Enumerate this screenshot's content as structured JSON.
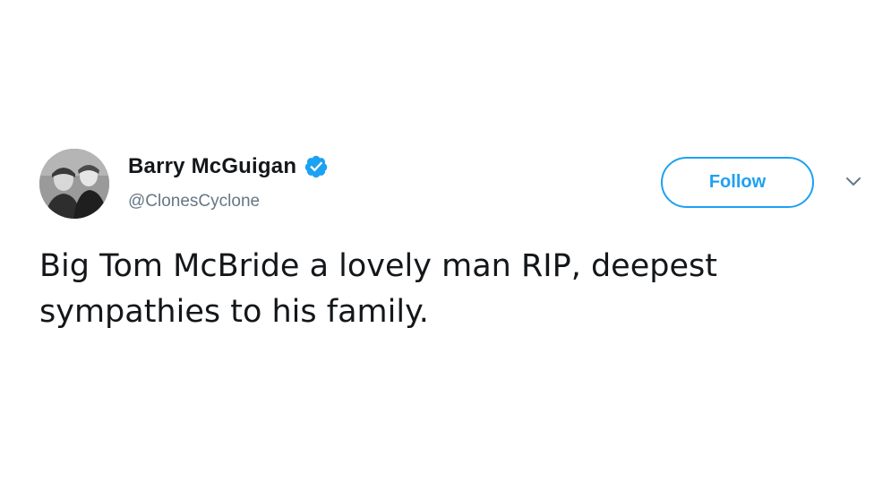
{
  "tweet": {
    "author": {
      "display_name": "Barry McGuigan",
      "handle": "@ClonesCyclone",
      "verified": true,
      "avatar_icon": "profile-photo"
    },
    "follow_label": "Follow",
    "menu_icon": "chevron-down-icon",
    "text": "Big Tom McBride a lovely man RIP, deepest sympathies to his family."
  },
  "colors": {
    "accent": "#1da1f2",
    "text_primary": "#14171a",
    "text_secondary": "#657786",
    "background": "#ffffff"
  }
}
